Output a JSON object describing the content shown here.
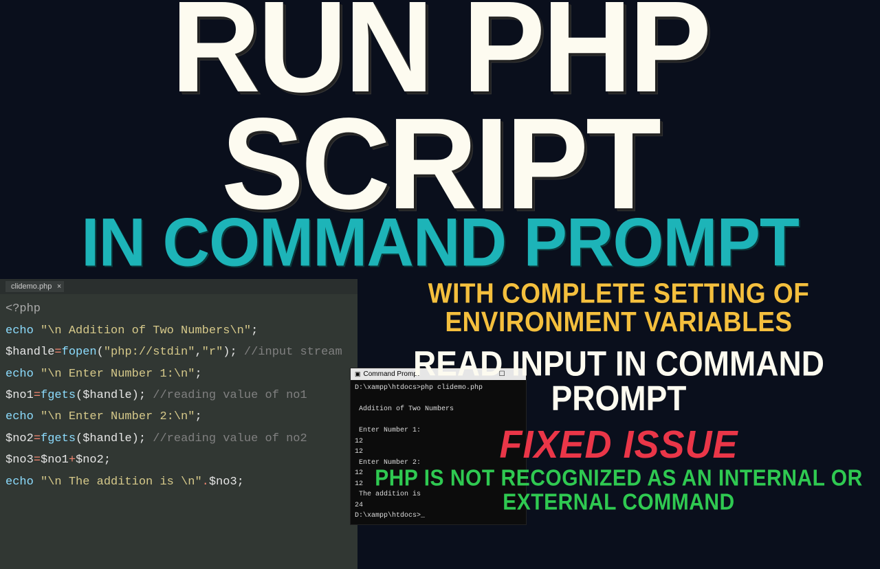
{
  "title": {
    "main": "RUN PHP SCRIPT",
    "sub": "IN COMMAND PROMPT"
  },
  "editor": {
    "tab": "clidemo.php",
    "code": {
      "l1_open": "<?php",
      "l2_echo": "echo",
      "l2_str": "\"\\n Addition of Two Numbers\\n\"",
      "l3_var": "$handle",
      "l3_fn": "fopen",
      "l3_arg1": "\"php://stdin\"",
      "l3_arg2": "\"r\"",
      "l3_cmt": "//input stream",
      "l4_str": "\"\\n Enter Number 1:\\n\"",
      "l5_var": "$no1",
      "l5_fn": "fgets",
      "l5_arg": "$handle",
      "l5_cmt": "//reading value of no1",
      "l6_str": "\"\\n Enter Number 2:\\n\"",
      "l7_var": "$no2",
      "l7_cmt": "//reading value of no2",
      "l8_var": "$no3",
      "l8_a": "$no1",
      "l8_b": "$no2",
      "l9_str": "\"\\n The addition is \\n\"",
      "l9_v": "$no3"
    }
  },
  "cmd": {
    "title": "Command Prompt",
    "body": "D:\\xampp\\htdocs>php clidemo.php\n\n Addition of Two Numbers\n\n Enter Number 1:\n12\n12\n Enter Number 2:\n12\n12\n The addition is\n24\nD:\\xampp\\htdocs>_"
  },
  "right": {
    "yellow": "WITH COMPLETE SETTING OF ENVIRONMENT VARIABLES",
    "white": "READ INPUT IN COMMAND PROMPT",
    "red": "FIXED ISSUE",
    "green": "PHP IS NOT RECOGNIZED AS AN INTERNAL OR EXTERNAL COMMAND"
  }
}
